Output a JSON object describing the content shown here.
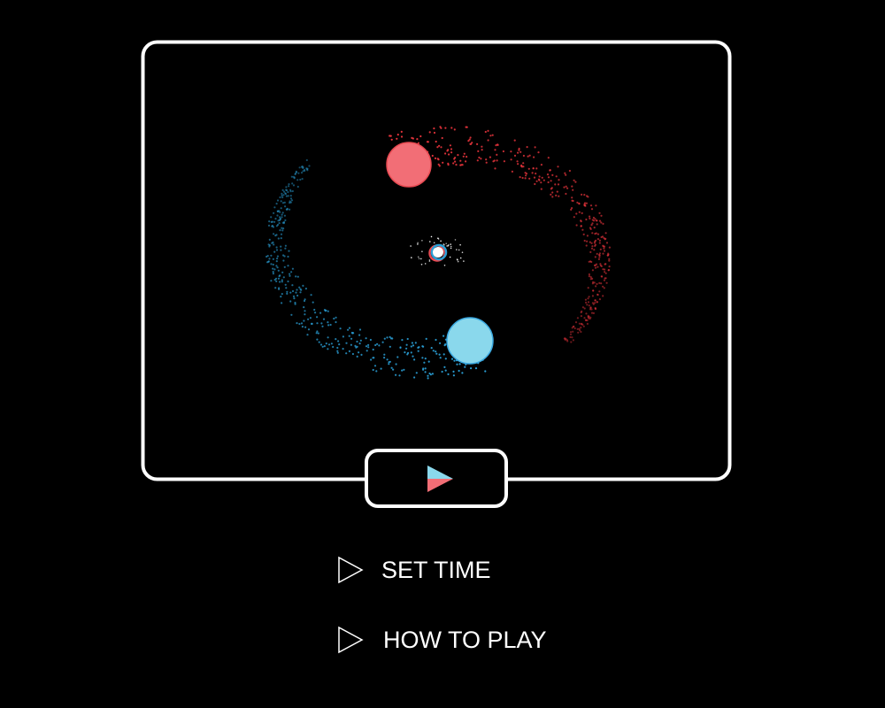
{
  "menu": {
    "set_time_label": "SET TIME",
    "how_to_play_label": "HOW TO PLAY"
  },
  "icons": {
    "play": "play-icon",
    "menu_arrow": "triangle-outline-icon"
  },
  "colors": {
    "background": "#000000",
    "frame": "#ffffff",
    "red_team": "#f26e76",
    "red_particles": "#e8343c",
    "blue_team": "#8ad8ec",
    "blue_particles": "#2a9fd6",
    "blue_outline": "#3aa8e0",
    "red_outline": "#e84a52"
  }
}
